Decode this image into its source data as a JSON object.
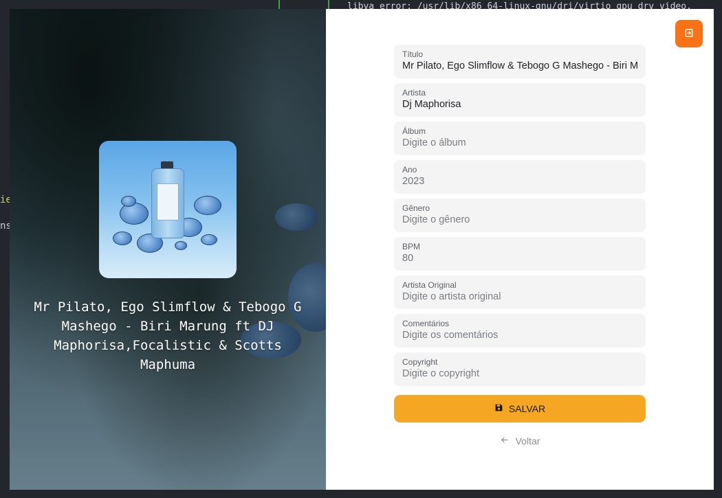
{
  "song": {
    "display_title": "Mr Pilato, Ego Slimflow & Tebogo G Mashego - Biri Marung ft DJ Maphorisa,Focalistic & Scotts Maphuma"
  },
  "form": {
    "fields": [
      {
        "label": "Título",
        "value": "Mr Pilato, Ego Slimflow & Tebogo G Mashego - Biri Mar",
        "placeholder": ""
      },
      {
        "label": "Artista",
        "value": "Dj Maphorisa",
        "placeholder": ""
      },
      {
        "label": "Álbum",
        "value": "",
        "placeholder": "Digite o álbum"
      },
      {
        "label": "Ano",
        "value": "2023",
        "placeholder": ""
      },
      {
        "label": "Gênero",
        "value": "",
        "placeholder": "Digite o gênero"
      },
      {
        "label": "BPM",
        "value": "80",
        "placeholder": ""
      },
      {
        "label": "Artista Original",
        "value": "",
        "placeholder": "Digite o artista original"
      },
      {
        "label": "Comentários",
        "value": "",
        "placeholder": "Digite os comentários"
      },
      {
        "label": "Copyright",
        "value": "",
        "placeholder": "Digite o copyright"
      }
    ],
    "save_label": "SALVAR",
    "back_label": "Voltar"
  },
  "icons": {
    "exit": "exit-icon",
    "save": "save-icon",
    "back": "arrow-left-icon"
  },
  "colors": {
    "accent_orange": "#f97316",
    "save_button": "#f5a623"
  },
  "background": {
    "terminal_line": "libva error: /usr/lib/x86_64-linux-gnu/dri/virtio_gpu_drv_video.",
    "side_text_1": "ie",
    "side_text_2": "ns"
  }
}
